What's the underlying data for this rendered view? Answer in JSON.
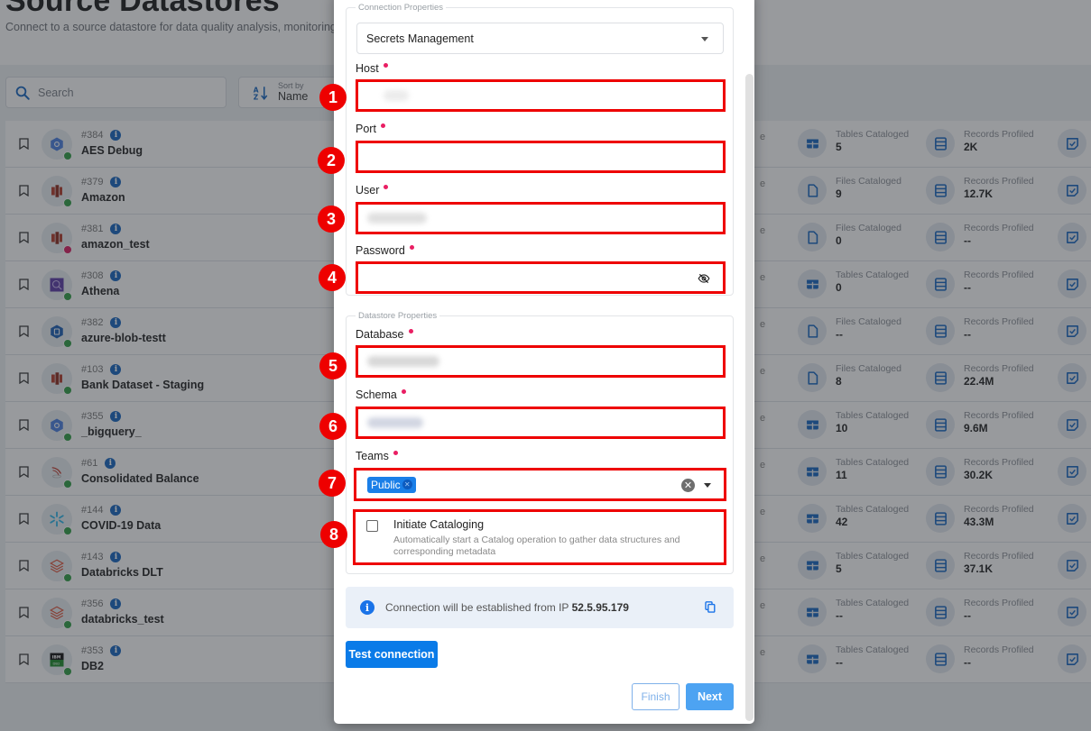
{
  "page": {
    "title": "Source Datastores",
    "subtitle": "Connect to a source datastore for data quality analysis, monitoring, a",
    "search_placeholder": "Search",
    "sort": {
      "caption": "Sort by",
      "value": "Name"
    }
  },
  "datastores": [
    {
      "id": "#384",
      "name": "AES Debug",
      "icon": "bigquery-icon",
      "status": "online",
      "stat1_label": "Tables Cataloged",
      "stat1_value": "5",
      "stat1_icon": "table-icon",
      "stat2_label": "Records Profiled",
      "stat2_value": "2K"
    },
    {
      "id": "#379",
      "name": "Amazon",
      "icon": "redshift-icon",
      "status": "online",
      "stat1_label": "Files Cataloged",
      "stat1_value": "9",
      "stat1_icon": "file-icon",
      "stat2_label": "Records Profiled",
      "stat2_value": "12.7K"
    },
    {
      "id": "#381",
      "name": "amazon_test",
      "icon": "redshift-icon",
      "status": "error",
      "stat1_label": "Files Cataloged",
      "stat1_value": "0",
      "stat1_icon": "file-icon",
      "stat2_label": "Records Profiled",
      "stat2_value": "--"
    },
    {
      "id": "#308",
      "name": "Athena",
      "icon": "athena-icon",
      "status": "online",
      "stat1_label": "Tables Cataloged",
      "stat1_value": "0",
      "stat1_icon": "table-icon",
      "stat2_label": "Records Profiled",
      "stat2_value": "--"
    },
    {
      "id": "#382",
      "name": "azure-blob-testt",
      "icon": "azure-blob-icon",
      "status": "online",
      "stat1_label": "Files Cataloged",
      "stat1_value": "--",
      "stat1_icon": "file-icon",
      "stat2_label": "Records Profiled",
      "stat2_value": "--"
    },
    {
      "id": "#103",
      "name": "Bank Dataset - Staging",
      "icon": "redshift-icon",
      "status": "online",
      "stat1_label": "Files Cataloged",
      "stat1_value": "8",
      "stat1_icon": "file-icon",
      "stat2_label": "Records Profiled",
      "stat2_value": "22.4M"
    },
    {
      "id": "#355",
      "name": "_bigquery_",
      "icon": "bigquery-icon",
      "status": "online",
      "stat1_label": "Tables Cataloged",
      "stat1_value": "10",
      "stat1_icon": "table-icon",
      "stat2_label": "Records Profiled",
      "stat2_value": "9.6M"
    },
    {
      "id": "#61",
      "name": "Consolidated Balance",
      "icon": "sqlserver-icon",
      "status": "online",
      "stat1_label": "Tables Cataloged",
      "stat1_value": "11",
      "stat1_icon": "table-icon",
      "stat2_label": "Records Profiled",
      "stat2_value": "30.2K"
    },
    {
      "id": "#144",
      "name": "COVID-19 Data",
      "icon": "snowflake-icon",
      "status": "online",
      "stat1_label": "Tables Cataloged",
      "stat1_value": "42",
      "stat1_icon": "table-icon",
      "stat2_label": "Records Profiled",
      "stat2_value": "43.3M"
    },
    {
      "id": "#143",
      "name": "Databricks DLT",
      "icon": "databricks-icon",
      "status": "online",
      "stat1_label": "Tables Cataloged",
      "stat1_value": "5",
      "stat1_icon": "table-icon",
      "stat2_label": "Records Profiled",
      "stat2_value": "37.1K"
    },
    {
      "id": "#356",
      "name": "databricks_test",
      "icon": "databricks-icon",
      "status": "online",
      "stat1_label": "Tables Cataloged",
      "stat1_value": "--",
      "stat1_icon": "table-icon",
      "stat2_label": "Records Profiled",
      "stat2_value": "--"
    },
    {
      "id": "#353",
      "name": "DB2",
      "icon": "db2-icon",
      "status": "online",
      "stat1_label": "Tables Cataloged",
      "stat1_value": "--",
      "stat1_icon": "table-icon",
      "stat2_label": "Records Profiled",
      "stat2_value": "--"
    }
  ],
  "row_cut_text": "e",
  "modal": {
    "connection_legend": "Connection Properties",
    "connection_type": "Secrets Management",
    "fields": {
      "host": {
        "label": "Host",
        "value": ""
      },
      "port": {
        "label": "Port",
        "value": ""
      },
      "user": {
        "label": "User",
        "value": ""
      },
      "password": {
        "label": "Password",
        "value": ""
      },
      "database": {
        "label": "Database",
        "value": ""
      },
      "schema": {
        "label": "Schema",
        "value": ""
      },
      "teams": {
        "label": "Teams",
        "selected": [
          "Public"
        ]
      }
    },
    "datastore_legend": "Datastore Properties",
    "initiate_cataloging": {
      "label": "Initiate Cataloging",
      "description": "Automatically start a Catalog operation to gather data structures and corresponding metadata",
      "checked": false
    },
    "ip_banner": {
      "prefix": "Connection will be established from IP ",
      "ip": "52.5.95.179"
    },
    "buttons": {
      "test": "Test connection",
      "finish": "Finish",
      "next": "Next"
    }
  },
  "callouts": [
    "1",
    "2",
    "3",
    "4",
    "5",
    "6",
    "7",
    "8"
  ],
  "colors": {
    "accent": "#0a7be8",
    "callout_red": "#ee0000",
    "status_online": "#2e9e44",
    "status_error": "#d81b60",
    "required_dot": "#e91e63"
  }
}
